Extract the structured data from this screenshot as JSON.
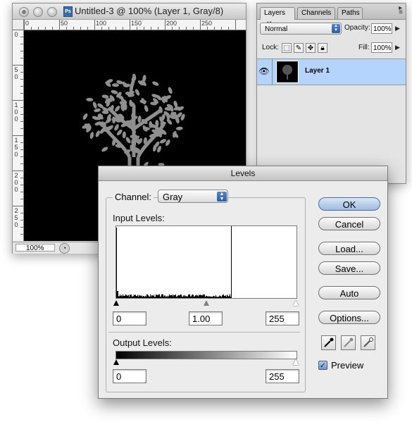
{
  "document": {
    "title": "Untitled-3 @ 100% (Layer 1, Gray/8)",
    "app_badge": "Ps",
    "zoom": "100%",
    "ruler_h": [
      "0",
      "50",
      "100",
      "150",
      "200",
      "250"
    ],
    "ruler_v": [
      "0",
      "5\n0",
      "1\n0\n0",
      "1\n5\n0",
      "2\n0\n0",
      "2\n5\n0"
    ]
  },
  "layers_panel": {
    "tabs": [
      "Layers",
      "Channels",
      "Paths"
    ],
    "blend_mode": "Normal",
    "opacity_label": "Opacity:",
    "opacity_value": "100%",
    "lock_label": "Lock:",
    "fill_label": "Fill:",
    "fill_value": "100%",
    "layer_name": "Layer 1"
  },
  "levels": {
    "title": "Levels",
    "channel_label": "Channel:",
    "channel_value": "Gray",
    "input_label": "Input Levels:",
    "input_black": "0",
    "input_gamma": "1.00",
    "input_white": "255",
    "output_label": "Output Levels:",
    "output_black": "0",
    "output_white": "255",
    "buttons": {
      "ok": "OK",
      "cancel": "Cancel",
      "load": "Load...",
      "save": "Save...",
      "auto": "Auto",
      "options": "Options..."
    },
    "preview_label": "Preview",
    "preview_checked": true,
    "histogram": {
      "spike_bin": 0,
      "max_bin": 163
    }
  },
  "colors": {
    "selection": "#b5d4fd",
    "default_button": "#9fbbe0",
    "canvas": "#000000",
    "tree": "#8f8f8f"
  }
}
